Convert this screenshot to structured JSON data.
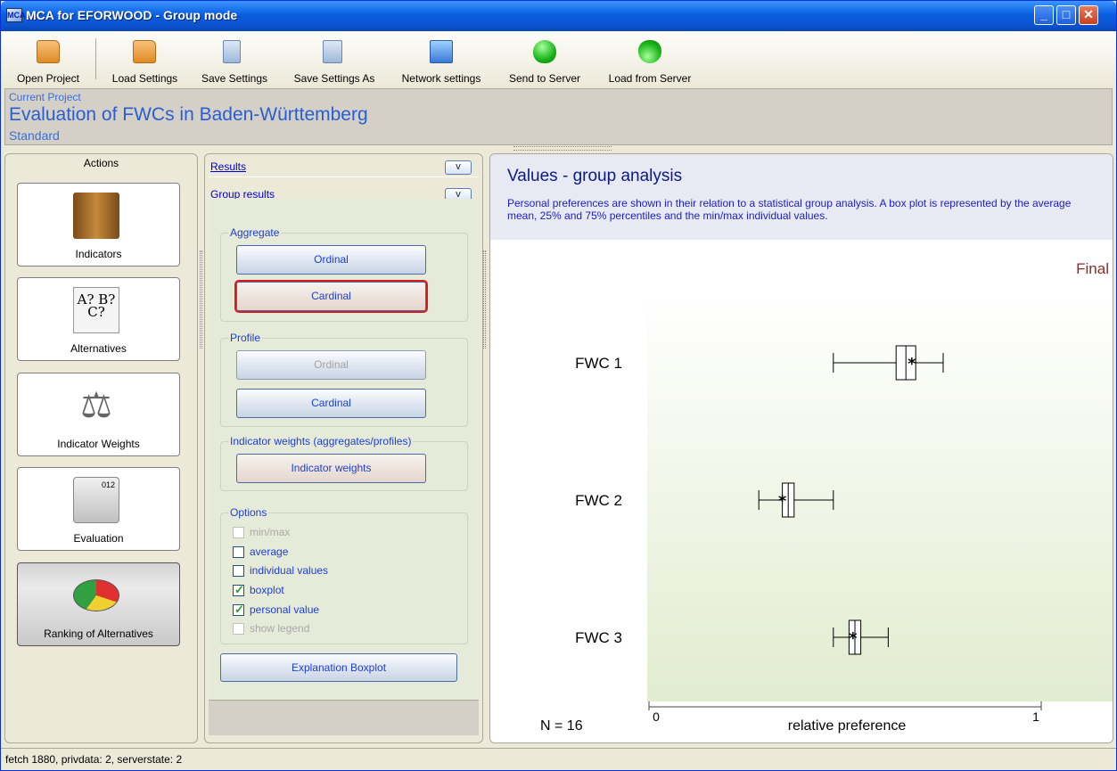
{
  "window": {
    "title": "MCA for EFORWOOD - Group mode",
    "icon_text": "MCA"
  },
  "toolbar": {
    "items": [
      {
        "label": "Open Project",
        "icon": "open-folder-icon"
      },
      {
        "label": "Load Settings",
        "icon": "folder-icon"
      },
      {
        "label": "Save Settings",
        "icon": "save-icon"
      },
      {
        "label": "Save Settings As",
        "icon": "save-as-icon"
      },
      {
        "label": "Network settings",
        "icon": "network-icon"
      },
      {
        "label": "Send to Server",
        "icon": "upload-arrow-icon"
      },
      {
        "label": "Load from Server",
        "icon": "download-arrow-icon"
      }
    ]
  },
  "project": {
    "label": "Current Project",
    "title": "Evaluation of FWCs in Baden-Württemberg",
    "variant": "Standard"
  },
  "actions": {
    "title": "Actions",
    "items": [
      {
        "label": "Indicators",
        "icon": "indicators-icon"
      },
      {
        "label": "Alternatives",
        "icon": "alternatives-icon",
        "icon_text": "A? B? C?"
      },
      {
        "label": "Indicator Weights",
        "icon": "scale-icon",
        "icon_text": "⚖"
      },
      {
        "label": "Evaluation",
        "icon": "calculator-icon",
        "icon_text": "012"
      },
      {
        "label": "Ranking of Alternatives",
        "icon": "pie-chart-icon",
        "active": true
      }
    ]
  },
  "middle": {
    "results_link": "Results",
    "group_results_link": "Group results",
    "toggle": "v",
    "aggregate": {
      "title": "Aggregate",
      "ordinal": "Ordinal",
      "cardinal": "Cardinal"
    },
    "profile": {
      "title": "Profile",
      "ordinal": "Ordinal",
      "cardinal": "Cardinal"
    },
    "weights": {
      "title": "Indicator weights (aggregates/profiles)",
      "button": "Indicator weights"
    },
    "options": {
      "title": "Options",
      "items": [
        {
          "label": "min/max",
          "checked": false,
          "disabled": true
        },
        {
          "label": "average",
          "checked": false,
          "disabled": false
        },
        {
          "label": "individual values",
          "checked": false,
          "disabled": false
        },
        {
          "label": "boxplot",
          "checked": true,
          "disabled": false
        },
        {
          "label": "personal value",
          "checked": true,
          "disabled": false
        },
        {
          "label": "show legend",
          "checked": false,
          "disabled": true
        }
      ]
    },
    "explanation_button": "Explanation Boxplot"
  },
  "main": {
    "title": "Values - group analysis",
    "description": "Personal preferences are shown in their relation to a statistical group analysis. A box plot is represented by the average mean, 25% and 75% percentiles and the min/max individual values.",
    "colors": {
      "plot_bg_top": "#ffffff",
      "plot_bg_bottom": "#e2eccf",
      "final_label": "#8b2b2b"
    }
  },
  "chart_data": {
    "type": "boxplot",
    "state_label": "Final",
    "n_label": "N = 16",
    "xlabel": "relative preference",
    "xlim": [
      0,
      1
    ],
    "tick_labels": [
      "0",
      "1"
    ],
    "series": [
      {
        "name": "FWC 1",
        "min": 0.47,
        "q1": 0.63,
        "q3": 0.68,
        "max": 0.75,
        "personal": 0.67
      },
      {
        "name": "FWC 2",
        "min": 0.28,
        "q1": 0.34,
        "q3": 0.37,
        "max": 0.47,
        "personal": 0.34
      },
      {
        "name": "FWC 3",
        "min": 0.47,
        "q1": 0.51,
        "q3": 0.54,
        "max": 0.61,
        "personal": 0.52
      }
    ]
  },
  "status": {
    "text": "fetch 1880, privdata: 2, serverstate: 2"
  }
}
